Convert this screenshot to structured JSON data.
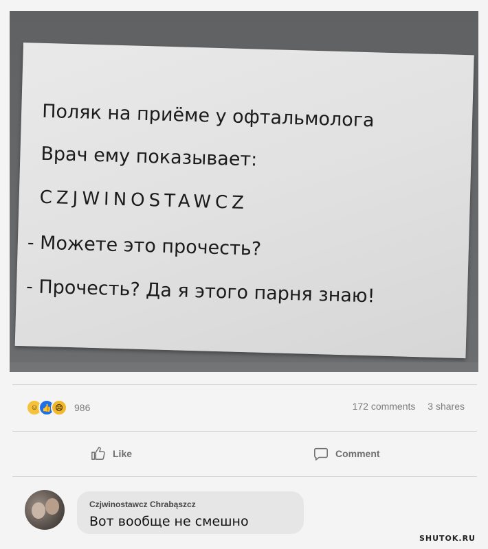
{
  "photo": {
    "lines": [
      "Поляк на приёме у офтальмолога",
      "Врач ему показывает:",
      "CZJWINOSTAWCZ",
      "- Можете это прочесть?",
      "- Прочесть? Да я этого парня знаю!"
    ]
  },
  "post": {
    "reaction_icons": [
      "haha-icon",
      "like-icon",
      "sad-icon"
    ],
    "reaction_count": "986",
    "comments_count": "172 comments",
    "shares_count": "3 shares",
    "like_label": "Like",
    "comment_label": "Comment"
  },
  "comment": {
    "author": "Czjwinostawcz Chrabąszcz",
    "text": "Вот вообще не смешно"
  },
  "watermark": "SHUTOK.RU",
  "colors": {
    "accent": "#1f6fe5",
    "bubble": "#e6e6e7"
  }
}
